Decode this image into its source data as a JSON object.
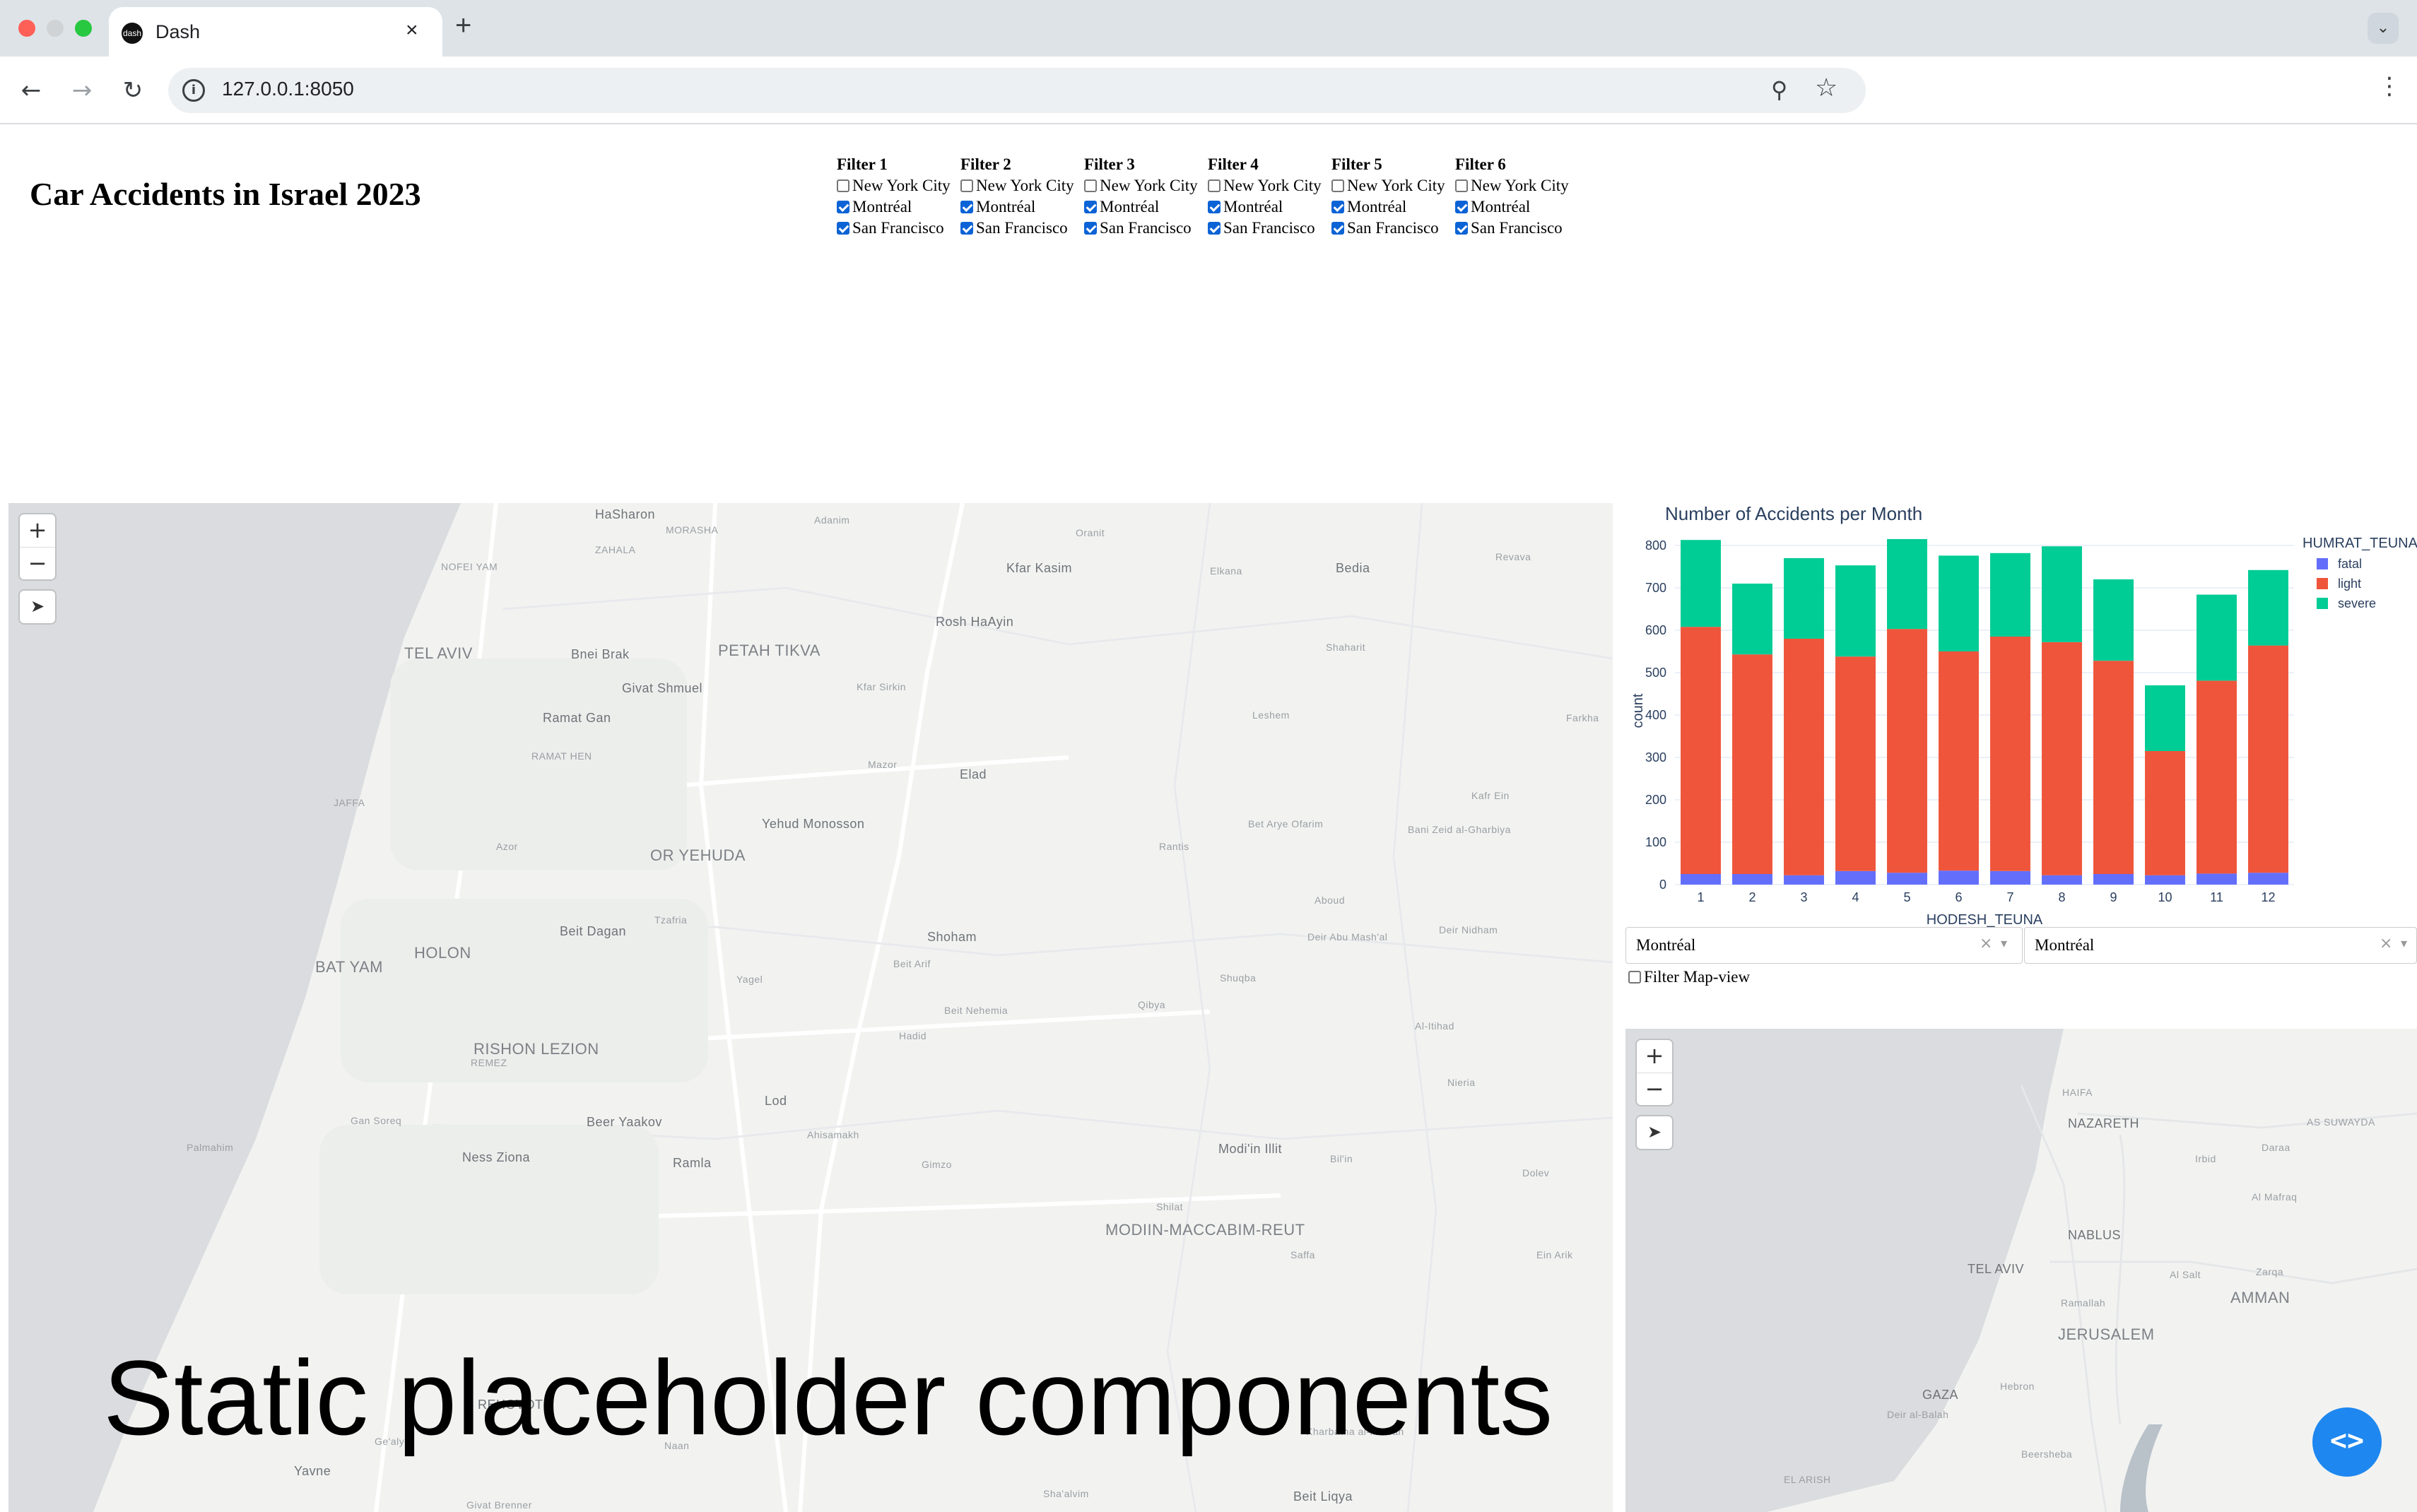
{
  "browser": {
    "tab_title": "Dash",
    "tab_close": "×",
    "new_tab": "+",
    "url": "127.0.0.1:8050",
    "back": "←",
    "forward": "→",
    "reload": "↻",
    "site_info": "i",
    "zoom": "⚲",
    "star": "☆",
    "menu": "⋮",
    "tab_search": "⌄",
    "favicon": "dash"
  },
  "page": {
    "title": "Car Accidents in Israel 2023",
    "filters": [
      {
        "label": "Filter 1",
        "options": [
          {
            "label": "New York City",
            "checked": false
          },
          {
            "label": "Montréal",
            "checked": true
          },
          {
            "label": "San Francisco",
            "checked": true
          }
        ]
      },
      {
        "label": "Filter 2",
        "options": [
          {
            "label": "New York City",
            "checked": false
          },
          {
            "label": "Montréal",
            "checked": true
          },
          {
            "label": "San Francisco",
            "checked": true
          }
        ]
      },
      {
        "label": "Filter 3",
        "options": [
          {
            "label": "New York City",
            "checked": false
          },
          {
            "label": "Montréal",
            "checked": true
          },
          {
            "label": "San Francisco",
            "checked": true
          }
        ]
      },
      {
        "label": "Filter 4",
        "options": [
          {
            "label": "New York City",
            "checked": false
          },
          {
            "label": "Montréal",
            "checked": true
          },
          {
            "label": "San Francisco",
            "checked": true
          }
        ]
      },
      {
        "label": "Filter 5",
        "options": [
          {
            "label": "New York City",
            "checked": false
          },
          {
            "label": "Montréal",
            "checked": true
          },
          {
            "label": "San Francisco",
            "checked": true
          }
        ]
      },
      {
        "label": "Filter 6",
        "options": [
          {
            "label": "New York City",
            "checked": false
          },
          {
            "label": "Montréal",
            "checked": true
          },
          {
            "label": "San Francisco",
            "checked": true
          }
        ]
      }
    ],
    "placeholder_overlay": "Static placeholder components"
  },
  "map_controls": {
    "zoom_in": "+",
    "zoom_out": "−",
    "locate": "➤"
  },
  "main_map": {
    "labels": [
      "HaSharon",
      "Adanim",
      "MORASHA",
      "Oranit",
      "ZAHALA",
      "NOFEI YAM",
      "Kfar Kasim",
      "Elkana",
      "Bedia",
      "Revava",
      "Rosh HaAyin",
      "TEL AVIV",
      "Bnei Brak",
      "PETAH TIKVA",
      "Shaharit",
      "Givat Shmuel",
      "Kfar Sirkin",
      "Leshem",
      "Farkha",
      "Ramat Gan",
      "RAMAT HEN",
      "Mazor",
      "Elad",
      "Kafr Ein",
      "JAFFA",
      "Yehud Monosson",
      "Bet Arye Ofarim",
      "Bani Zeid al-Gharbiya",
      "Azor",
      "OR YEHUDA",
      "Rantis",
      "BAT YAM",
      "HOLON",
      "Aboud",
      "Tzafria",
      "Beit Dagan",
      "Shoham",
      "Deir Abu Mash'al",
      "Deir Nidham",
      "Beit Arif",
      "Yagel",
      "Shuqba",
      "Beit Nehemia",
      "Qibya",
      "Hadid",
      "Al-Itihad",
      "RISHON LEZION",
      "REMEZ",
      "Lod",
      "Nieria",
      "Gan Soreq",
      "Beer Yaakov",
      "Ahisamakh",
      "Palmahim",
      "Ness Ziona",
      "Ramla",
      "Gimzo",
      "Modi'in Illit",
      "Bil'in",
      "Dolev",
      "Shilat",
      "MODIIN-MACCABIM-REUT",
      "Saffa",
      "Ein Arik",
      "REHOVOT",
      "Ge'alya",
      "Naan",
      "Kharbatha al-Misbah",
      "Yavne",
      "Givat Brenner",
      "Sha'alvim",
      "Beit Liqya"
    ]
  },
  "chart_data": {
    "type": "bar",
    "stacked": true,
    "title": "Number of Accidents per Month",
    "xlabel": "HODESH_TEUNA",
    "ylabel": "count",
    "legend_title": "HUMRAT_TEUNA",
    "legend_position": "right",
    "categories": [
      "1",
      "2",
      "3",
      "4",
      "5",
      "6",
      "7",
      "8",
      "9",
      "10",
      "11",
      "12"
    ],
    "ylim": [
      0,
      820
    ],
    "yticks": [
      0,
      100,
      200,
      300,
      400,
      500,
      600,
      700,
      800
    ],
    "series": [
      {
        "name": "fatal",
        "color": "#636efa",
        "values": [
          25,
          25,
          22,
          32,
          28,
          33,
          32,
          22,
          25,
          22,
          26,
          28
        ]
      },
      {
        "name": "light",
        "color": "#ef553b",
        "values": [
          583,
          518,
          558,
          506,
          575,
          517,
          553,
          550,
          503,
          293,
          455,
          536
        ]
      },
      {
        "name": "severe",
        "color": "#00cc96",
        "values": [
          205,
          167,
          190,
          215,
          212,
          226,
          197,
          226,
          192,
          155,
          203,
          178
        ]
      }
    ]
  },
  "controls": {
    "dropdown_left": {
      "value": "Montréal",
      "clear": "×",
      "arrow": "▾"
    },
    "dropdown_right": {
      "value": "Montréal",
      "clear": "×",
      "arrow": "▾"
    },
    "filter_map_view": {
      "label": "Filter Map-view",
      "checked": false
    }
  },
  "small_map": {
    "labels": [
      "HAIFA",
      "NAZARETH",
      "AS SUWAYDA",
      "Irbid",
      "Daraa",
      "Al Mafraq",
      "NABLUS",
      "TEL AVIV",
      "Al Salt",
      "Zarqa",
      "Ramallah",
      "AMMAN",
      "JERUSALEM",
      "GAZA",
      "Deir al-Balah",
      "Hebron",
      "Beersheba",
      "EL ARISH"
    ]
  },
  "devtools": {
    "label": "<>"
  }
}
